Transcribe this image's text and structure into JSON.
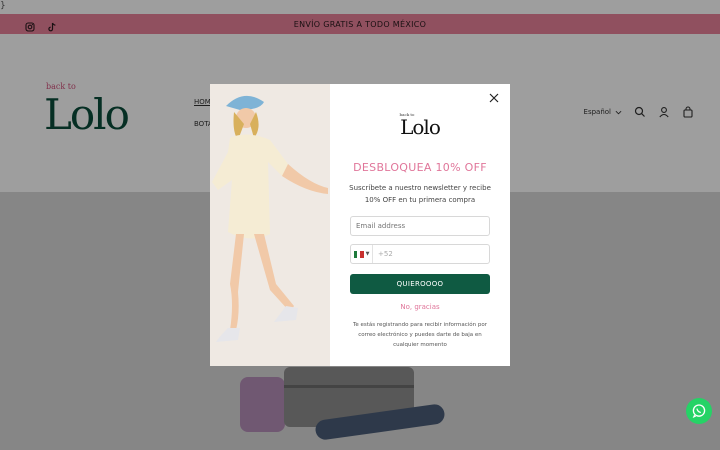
{
  "corner_text": "}",
  "announcement": {
    "text": "ENVÍO GRATIS A TODO MÉXICO",
    "icons": [
      "instagram-icon",
      "tiktok-icon"
    ]
  },
  "header": {
    "logo_small": "back to",
    "logo_big": "Lolo",
    "nav": [
      "HOME",
      "BOTA"
    ],
    "language": "Español",
    "icons": [
      "chevron-down-icon",
      "search-icon",
      "user-icon",
      "cart-icon"
    ]
  },
  "modal": {
    "logo_small": "back to",
    "logo_big": "Lolo",
    "title": "DESBLOQUEA 10% OFF",
    "subtitle": "Suscríbete a nuestro newsletter y recibe 10% OFF en tu primera compra",
    "email_placeholder": "Email address",
    "phone_prefix": "+52",
    "submit_label": "QUIEROOOO",
    "decline_label": "No, gracias",
    "disclaimer": "Te estás registrando para recibir información por correo electrónico y puedes darte de baja en cualquier momento"
  },
  "colors": {
    "announcement_bg": "#e8829a",
    "brand_green": "#0f5a42",
    "brand_pink": "#e0769a",
    "whatsapp": "#25d366"
  }
}
